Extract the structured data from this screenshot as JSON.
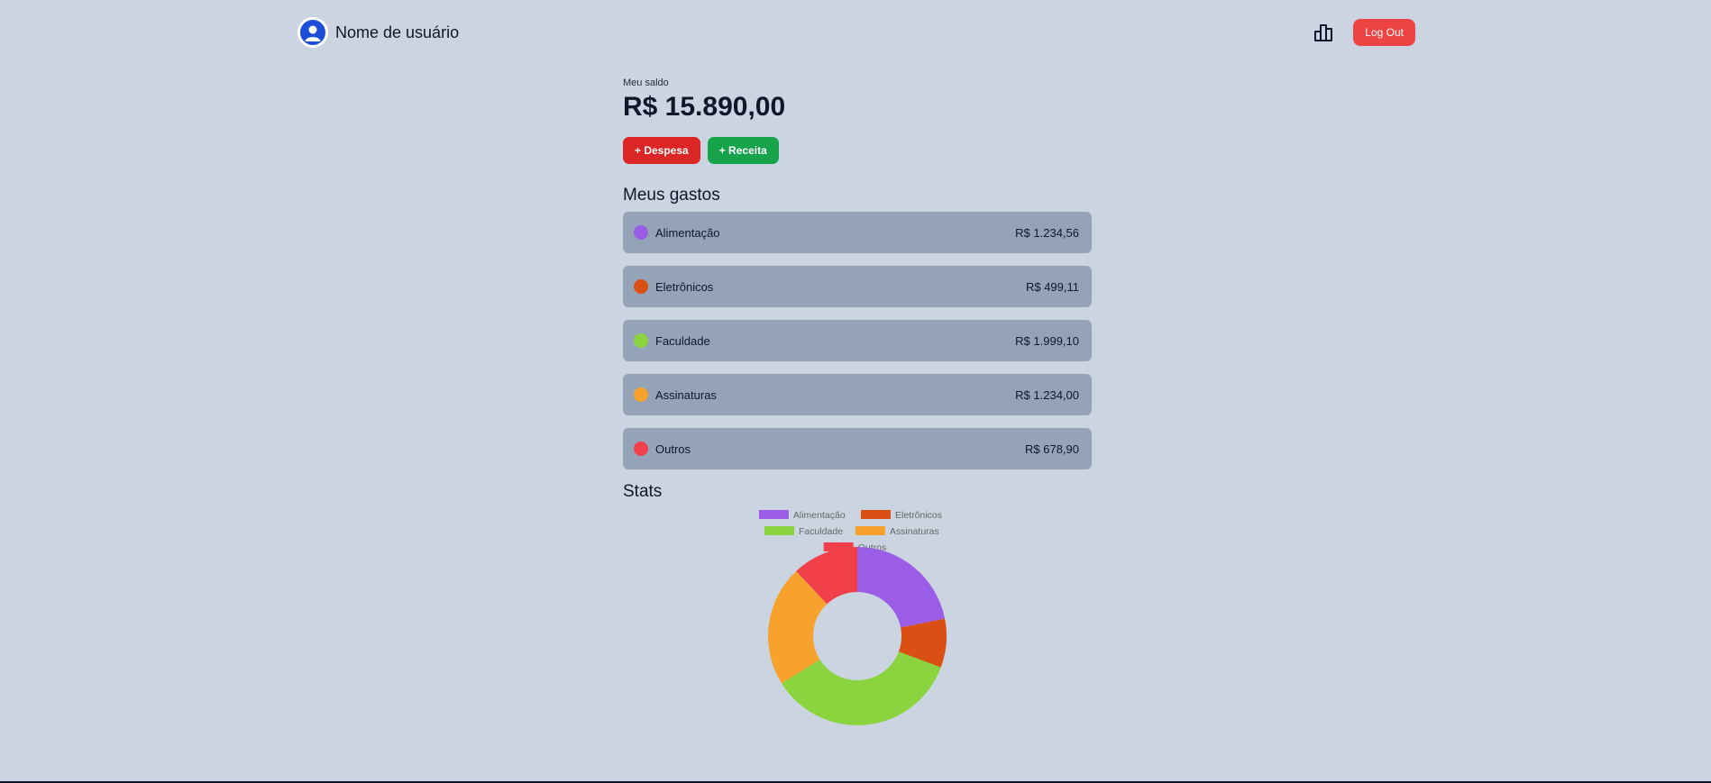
{
  "header": {
    "username": "Nome de usuário",
    "stats_icon": "bar-chart-icon",
    "avatar_icon": "user-icon",
    "logout_label": "Log Out"
  },
  "balance": {
    "label": "Meu saldo",
    "value": "R$ 15.890,00"
  },
  "actions": {
    "expense_label": "+ Despesa",
    "income_label": "+ Receita"
  },
  "expenses": {
    "title": "Meus gastos",
    "items": [
      {
        "label": "Alimentação",
        "value": "R$ 1.234,56",
        "color": "#9b5de5"
      },
      {
        "label": "Eletrônicos",
        "value": "R$ 499,11",
        "color": "#d94f14"
      },
      {
        "label": "Faculdade",
        "value": "R$ 1.999,10",
        "color": "#8bd33f"
      },
      {
        "label": "Assinaturas",
        "value": "R$ 1.234,00",
        "color": "#f6a22c"
      },
      {
        "label": "Outros",
        "value": "R$ 678,90",
        "color": "#f2404a"
      }
    ]
  },
  "stats": {
    "title": "Stats"
  },
  "chart_data": {
    "type": "pie",
    "doughnut": true,
    "categories": [
      "Alimentação",
      "Eletrônicos",
      "Faculdade",
      "Assinaturas",
      "Outros"
    ],
    "values": [
      1234.56,
      499.11,
      1999.1,
      1234.0,
      678.9
    ],
    "colors": [
      "#9b5de5",
      "#d94f14",
      "#8bd33f",
      "#f6a22c",
      "#f2404a"
    ],
    "legend": "top"
  }
}
